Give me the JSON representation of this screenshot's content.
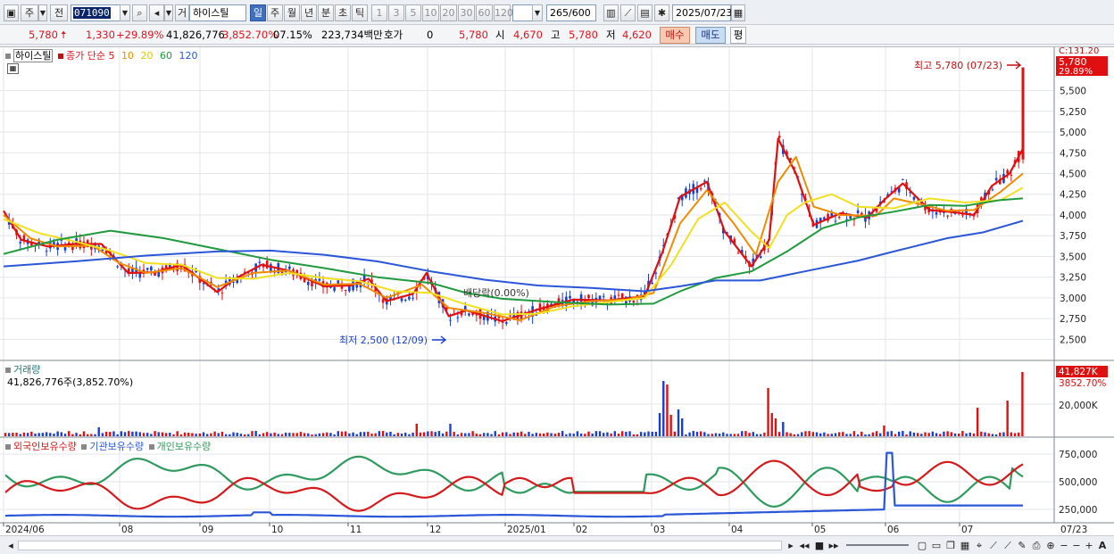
{
  "toolbar": {
    "market": "주",
    "whole": "전",
    "code": "071090",
    "exchange": "거",
    "name": "하이스틸",
    "periods": [
      "일",
      "주",
      "월",
      "년",
      "분",
      "초",
      "틱"
    ],
    "period_active": "일",
    "intervals": [
      "1",
      "3",
      "5",
      "10",
      "20",
      "30",
      "60",
      "120"
    ],
    "count": "265",
    "count_max": "/600",
    "date": "2025/07/23"
  },
  "quote": {
    "price": "5,780",
    "change": "1,330",
    "change_pct": "+29.89%",
    "volume": "41,826,776",
    "vol_ratio": "3,852.70%",
    "turnover": "07.15%",
    "amount": "223,734백만",
    "hoga_label": "호가",
    "hoga_value": "0",
    "ask": "5,780",
    "open_label": "시",
    "open": "4,670",
    "high_label": "고",
    "high": "5,780",
    "low_label": "저",
    "low": "4,620",
    "buy": "매수",
    "sell": "매도",
    "eval": "평"
  },
  "price_legend": {
    "name": "하이스틸",
    "ma_label": "종가 단순",
    "ma_periods": [
      "5",
      "10",
      "20",
      "60",
      "120"
    ],
    "ma_colors": [
      "#e01010",
      "#f08a00",
      "#f0e020",
      "#1f9a3c",
      "#2a56d8"
    ]
  },
  "annotations": {
    "high": "최고 5,780 (07/23)",
    "low": "최저 2,500 (12/09)",
    "dividend": "배당락(0.00%)",
    "last_price": "5,780",
    "last_pct": "29.89%",
    "axis_top": "C:131.20"
  },
  "volume_pane": {
    "title": "거래량",
    "summary": "41,826,776주(3,852.70%)",
    "last_tag": "41,827K",
    "last_pct": "3852.70%",
    "axis_label": "20,000K"
  },
  "holding_pane": {
    "legend": [
      "외국인보유수량",
      "기관보유수량",
      "개인보유수량"
    ],
    "colors": [
      "#d41a1a",
      "#2a56d8",
      "#2e9a5e"
    ],
    "axis_labels": [
      "750,000",
      "500,000",
      "250,000"
    ]
  },
  "x_axis": [
    "2024/06",
    "08",
    "09",
    "10",
    "11",
    "12",
    "2025/01",
    "02",
    "03",
    "04",
    "05",
    "06",
    "07"
  ],
  "x_axis_right": "07/23",
  "chart_data": {
    "type": "candlestick",
    "price_axis": [
      "5,500",
      "5,250",
      "5,000",
      "4,750",
      "4,500",
      "4,250",
      "4,000",
      "3,750",
      "3,500",
      "3,250",
      "3,000",
      "2,750",
      "2,500"
    ],
    "ylim": [
      2300,
      5850
    ],
    "ma_series": [
      {
        "name": "5",
        "color": "#e01010",
        "values": [
          [
            0,
            4050
          ],
          [
            20,
            3700
          ],
          [
            50,
            3620
          ],
          [
            80,
            3650
          ],
          [
            110,
            3650
          ],
          [
            140,
            3300
          ],
          [
            170,
            3310
          ],
          [
            200,
            3400
          ],
          [
            240,
            3070
          ],
          [
            260,
            3230
          ],
          [
            290,
            3400
          ],
          [
            320,
            3330
          ],
          [
            360,
            3140
          ],
          [
            390,
            3150
          ],
          [
            410,
            3230
          ],
          [
            430,
            2960
          ],
          [
            460,
            3050
          ],
          [
            475,
            3300
          ],
          [
            500,
            2780
          ],
          [
            520,
            2850
          ],
          [
            560,
            2720
          ],
          [
            600,
            2860
          ],
          [
            640,
            2980
          ],
          [
            680,
            2970
          ],
          [
            720,
            3020
          ],
          [
            740,
            3550
          ],
          [
            760,
            4220
          ],
          [
            790,
            4400
          ],
          [
            810,
            3800
          ],
          [
            840,
            3380
          ],
          [
            860,
            3700
          ],
          [
            870,
            4920
          ],
          [
            890,
            4500
          ],
          [
            910,
            3880
          ],
          [
            940,
            4020
          ],
          [
            970,
            3970
          ],
          [
            990,
            4190
          ],
          [
            1010,
            4380
          ],
          [
            1040,
            4060
          ],
          [
            1070,
            4030
          ],
          [
            1090,
            4000
          ],
          [
            1110,
            4350
          ],
          [
            1130,
            4500
          ],
          [
            1145,
            4800
          ]
        ]
      },
      {
        "name": "10",
        "color": "#f08a00",
        "values": [
          [
            0,
            4000
          ],
          [
            30,
            3720
          ],
          [
            60,
            3620
          ],
          [
            100,
            3630
          ],
          [
            130,
            3420
          ],
          [
            160,
            3300
          ],
          [
            200,
            3360
          ],
          [
            240,
            3130
          ],
          [
            280,
            3300
          ],
          [
            320,
            3330
          ],
          [
            360,
            3160
          ],
          [
            400,
            3170
          ],
          [
            430,
            3000
          ],
          [
            470,
            3160
          ],
          [
            500,
            2880
          ],
          [
            540,
            2820
          ],
          [
            580,
            2730
          ],
          [
            620,
            2900
          ],
          [
            660,
            2960
          ],
          [
            700,
            2980
          ],
          [
            730,
            3060
          ],
          [
            760,
            3900
          ],
          [
            790,
            4300
          ],
          [
            820,
            3900
          ],
          [
            845,
            3520
          ],
          [
            870,
            4400
          ],
          [
            890,
            4700
          ],
          [
            910,
            4100
          ],
          [
            940,
            4000
          ],
          [
            980,
            3990
          ],
          [
            1000,
            4200
          ],
          [
            1030,
            4130
          ],
          [
            1060,
            4050
          ],
          [
            1090,
            4060
          ],
          [
            1120,
            4280
          ],
          [
            1145,
            4500
          ]
        ]
      },
      {
        "name": "20",
        "color": "#f0e020",
        "values": [
          [
            0,
            3950
          ],
          [
            40,
            3780
          ],
          [
            80,
            3680
          ],
          [
            120,
            3570
          ],
          [
            160,
            3420
          ],
          [
            200,
            3400
          ],
          [
            240,
            3240
          ],
          [
            280,
            3230
          ],
          [
            320,
            3300
          ],
          [
            360,
            3240
          ],
          [
            400,
            3200
          ],
          [
            440,
            3080
          ],
          [
            480,
            3060
          ],
          [
            520,
            2920
          ],
          [
            560,
            2800
          ],
          [
            600,
            2810
          ],
          [
            640,
            2900
          ],
          [
            680,
            2950
          ],
          [
            720,
            3000
          ],
          [
            750,
            3400
          ],
          [
            780,
            3950
          ],
          [
            810,
            4150
          ],
          [
            840,
            3800
          ],
          [
            860,
            3600
          ],
          [
            880,
            4000
          ],
          [
            900,
            4150
          ],
          [
            930,
            4250
          ],
          [
            960,
            4100
          ],
          [
            1000,
            4080
          ],
          [
            1040,
            4200
          ],
          [
            1080,
            4150
          ],
          [
            1120,
            4180
          ],
          [
            1145,
            4330
          ]
        ]
      },
      {
        "name": "60",
        "color": "#1f9a3c",
        "values": [
          [
            0,
            3530
          ],
          [
            60,
            3700
          ],
          [
            120,
            3810
          ],
          [
            180,
            3720
          ],
          [
            240,
            3590
          ],
          [
            300,
            3460
          ],
          [
            360,
            3360
          ],
          [
            420,
            3250
          ],
          [
            480,
            3180
          ],
          [
            520,
            3060
          ],
          [
            560,
            2990
          ],
          [
            620,
            2950
          ],
          [
            680,
            2920
          ],
          [
            730,
            2930
          ],
          [
            760,
            3080
          ],
          [
            800,
            3240
          ],
          [
            840,
            3320
          ],
          [
            880,
            3560
          ],
          [
            920,
            3840
          ],
          [
            960,
            3970
          ],
          [
            1000,
            4040
          ],
          [
            1040,
            4120
          ],
          [
            1080,
            4110
          ],
          [
            1120,
            4180
          ],
          [
            1145,
            4200
          ]
        ]
      },
      {
        "name": "120",
        "color": "#2a56d8",
        "values": [
          [
            0,
            3380
          ],
          [
            80,
            3440
          ],
          [
            160,
            3510
          ],
          [
            240,
            3560
          ],
          [
            300,
            3570
          ],
          [
            360,
            3520
          ],
          [
            420,
            3440
          ],
          [
            480,
            3320
          ],
          [
            540,
            3220
          ],
          [
            600,
            3150
          ],
          [
            660,
            3120
          ],
          [
            720,
            3080
          ],
          [
            760,
            3140
          ],
          [
            800,
            3210
          ],
          [
            850,
            3210
          ],
          [
            900,
            3320
          ],
          [
            960,
            3450
          ],
          [
            1000,
            3560
          ],
          [
            1060,
            3720
          ],
          [
            1100,
            3790
          ],
          [
            1145,
            3930
          ]
        ]
      }
    ]
  }
}
